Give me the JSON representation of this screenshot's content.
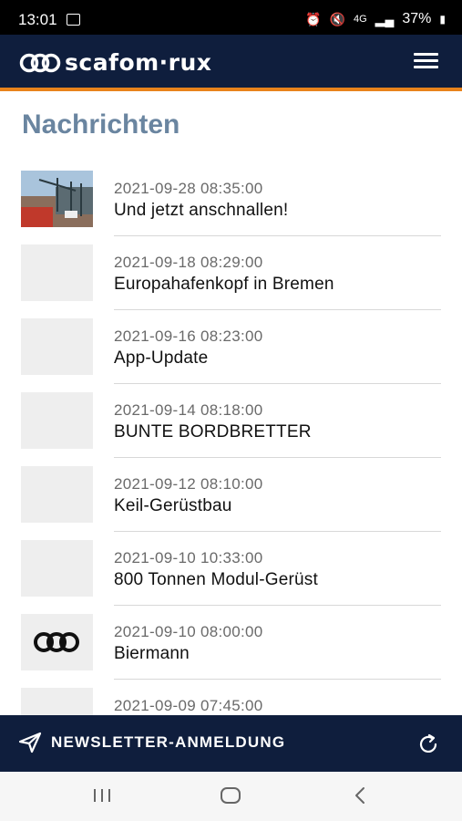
{
  "status_bar": {
    "time": "13:01",
    "battery": "37%",
    "icons": [
      "gallery-icon",
      "alarm-icon",
      "mute-icon",
      "4g-icon",
      "signal-icon",
      "battery-icon"
    ]
  },
  "app_bar": {
    "brand": "scafom·rux",
    "menu_icon": "hamburger-menu-icon"
  },
  "page": {
    "title": "Nachrichten"
  },
  "news": [
    {
      "date": "2021-09-28 08:35:00",
      "title": "Und jetzt anschnallen!",
      "thumb": "photo"
    },
    {
      "date": "2021-09-18 08:29:00",
      "title": "Europahafenkopf in Bremen",
      "thumb": "placeholder"
    },
    {
      "date": "2021-09-16 08:23:00",
      "title": "App-Update",
      "thumb": "placeholder"
    },
    {
      "date": "2021-09-14 08:18:00",
      "title": "BUNTE BORDBRETTER",
      "thumb": "placeholder"
    },
    {
      "date": "2021-09-12 08:10:00",
      "title": "Keil-Gerüstbau",
      "thumb": "placeholder"
    },
    {
      "date": "2021-09-10 10:33:00",
      "title": "800 Tonnen Modul-Gerüst",
      "thumb": "placeholder"
    },
    {
      "date": "2021-09-10 08:00:00",
      "title": "Biermann",
      "thumb": "logo"
    },
    {
      "date": "2021-09-09 07:45:00",
      "title": "",
      "thumb": "placeholder"
    }
  ],
  "bottom_bar": {
    "newsletter_label": "NEWSLETTER-ANMELDUNG",
    "newsletter_icon": "send-icon",
    "refresh_icon": "refresh-icon"
  },
  "colors": {
    "navy": "#0f1e3d",
    "accent_orange": "#e8831c",
    "title_blue": "#6a85a0"
  }
}
